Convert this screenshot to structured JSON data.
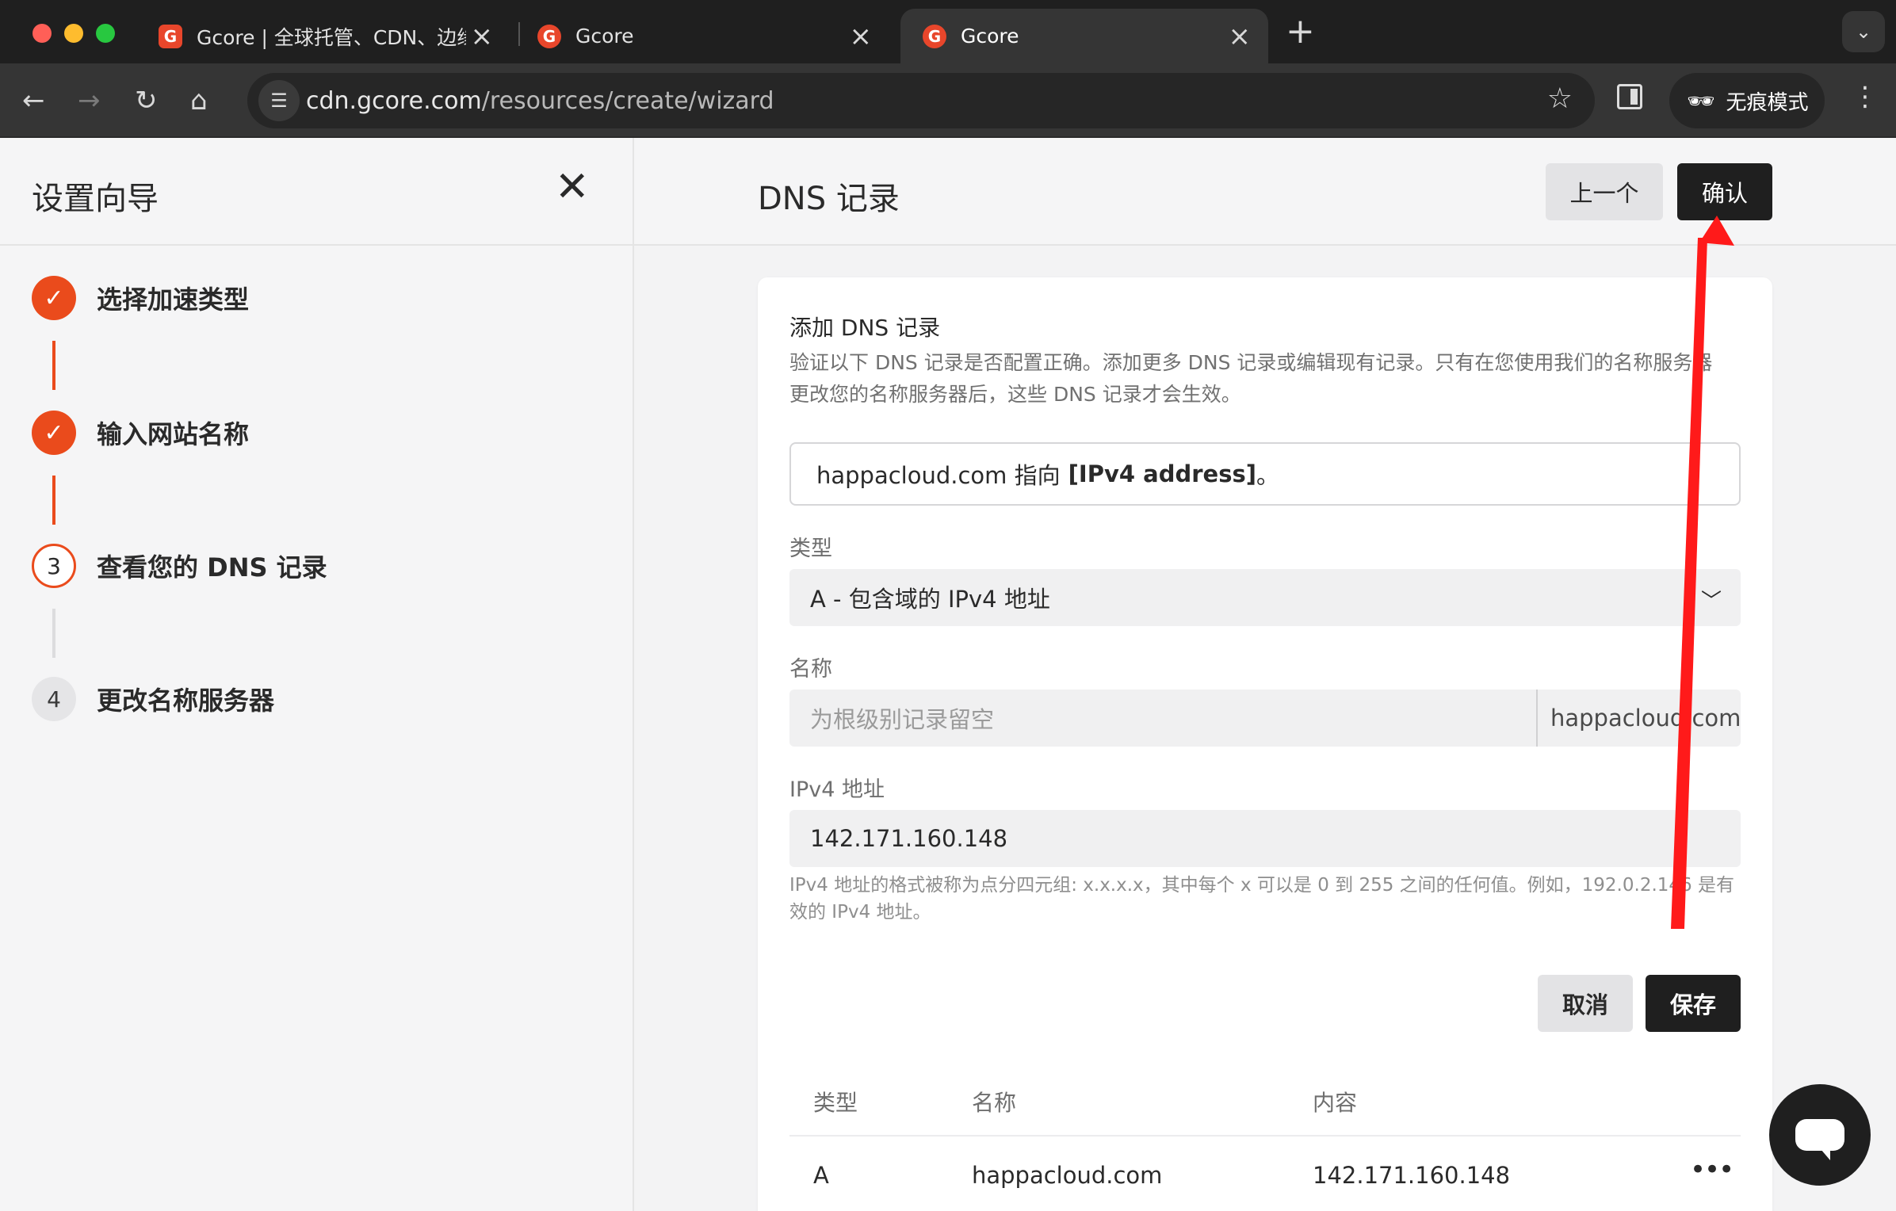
{
  "browser": {
    "tabs": [
      {
        "title": "Gcore | 全球托管、CDN、边缘",
        "active": false
      },
      {
        "title": "Gcore",
        "active": false
      },
      {
        "title": "Gcore",
        "active": true
      }
    ],
    "url_host": "cdn.gcore.com",
    "url_path": "/resources/create/wizard",
    "incognito_label": "无痕模式"
  },
  "wizard": {
    "title": "设置向导",
    "steps": [
      {
        "marker": "✓",
        "label": "选择加速类型",
        "state": "done"
      },
      {
        "marker": "✓",
        "label": "输入网站名称",
        "state": "done"
      },
      {
        "marker": "3",
        "label": "查看您的 DNS 记录",
        "state": "current"
      },
      {
        "marker": "4",
        "label": "更改名称服务器",
        "state": "todo"
      }
    ]
  },
  "main": {
    "title": "DNS 记录",
    "prev_label": "上一个",
    "confirm_label": "确认"
  },
  "card": {
    "title": "添加 DNS 记录",
    "description": "验证以下 DNS 记录是否配置正确。添加更多 DNS 记录或编辑现有记录。只有在您使用我们的名称服务器更改您的名称服务器后，这些 DNS 记录才会生效。",
    "record_prefix": "happacloud.com 指向",
    "record_bold": "[IPv4 address]",
    "record_suffix": "。",
    "type_label": "类型",
    "type_value": "A - 包含域的 IPv4 地址",
    "name_label": "名称",
    "name_placeholder": "为根级别记录留空",
    "name_suffix": "happacloud.com",
    "ipv4_label": "IPv4 地址",
    "ipv4_value": "142.171.160.148",
    "hint": "IPv4 地址的格式被称为点分四元组: x.x.x.x，其中每个 x 可以是 0 到 255 之间的任何值。例如，192.0.2.146 是有效的 IPv4 地址。",
    "cancel_label": "取消",
    "save_label": "保存"
  },
  "table": {
    "headers": [
      "类型",
      "名称",
      "内容"
    ],
    "rows": [
      {
        "type": "A",
        "name": "happacloud.com",
        "content": "142.171.160.148"
      }
    ],
    "more_glyph": "•••"
  },
  "colors": {
    "accent": "#ea4b1c",
    "dark_button": "#1f1f1f",
    "annotation_arrow": "#ff1a1a"
  }
}
